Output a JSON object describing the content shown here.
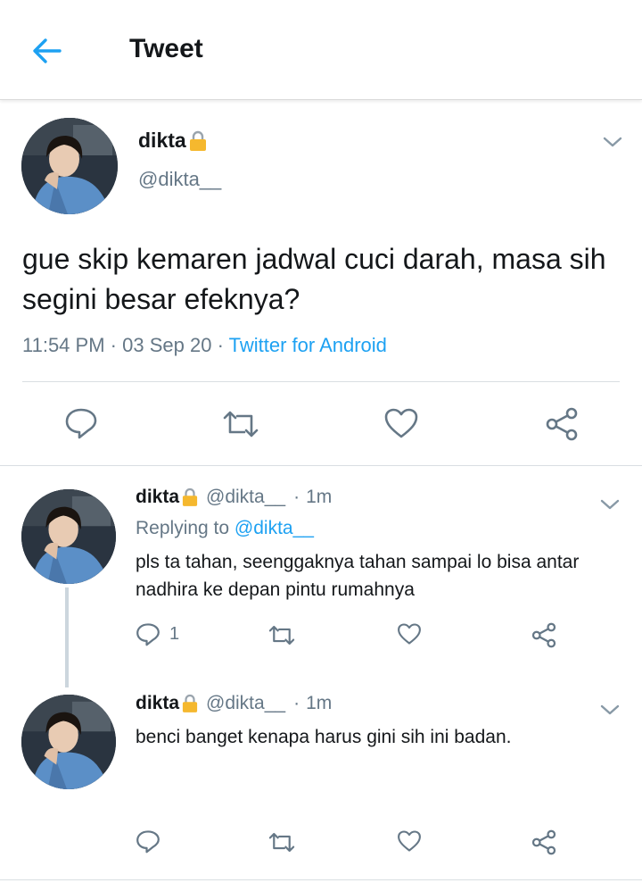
{
  "header": {
    "title": "Tweet"
  },
  "main_tweet": {
    "author_name": "dikta",
    "handle": "@dikta__",
    "text": "gue skip kemaren jadwal cuci darah, masa sih segini besar efeknya?",
    "time": "11:54 PM",
    "date": "03 Sep 20",
    "source": "Twitter for Android"
  },
  "replies": [
    {
      "author_name": "dikta",
      "handle": "@dikta__",
      "time": "1m",
      "replying_prefix": "Replying to ",
      "replying_to": "@dikta__",
      "text": "pls ta tahan, seenggaknya tahan sampai lo bisa antar nadhira ke depan pintu rumahnya",
      "reply_count": "1"
    },
    {
      "author_name": "dikta",
      "handle": "@dikta__",
      "time": "1m",
      "text": "benci banget kenapa harus gini sih ini badan.",
      "reply_count": ""
    }
  ],
  "colors": {
    "accent": "#1da1f2",
    "secondary_text": "#657786",
    "divider": "#d9dee2",
    "lock": "#f5b82e"
  },
  "icons": [
    "back-arrow-icon",
    "lock-icon",
    "chevron-down-icon",
    "reply-icon",
    "retweet-icon",
    "like-icon",
    "share-icon"
  ]
}
